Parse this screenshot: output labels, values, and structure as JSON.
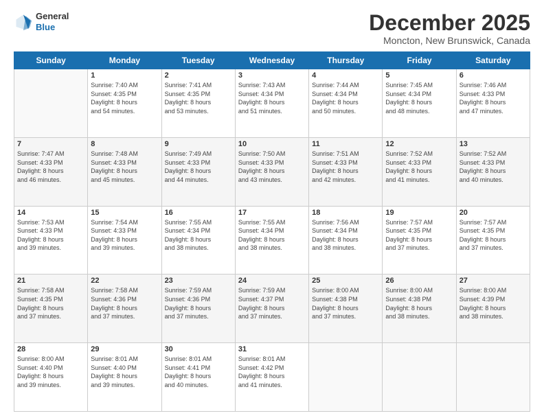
{
  "header": {
    "logo_line1": "General",
    "logo_line2": "Blue",
    "month_title": "December 2025",
    "location": "Moncton, New Brunswick, Canada"
  },
  "days_of_week": [
    "Sunday",
    "Monday",
    "Tuesday",
    "Wednesday",
    "Thursday",
    "Friday",
    "Saturday"
  ],
  "weeks": [
    [
      {
        "day": "",
        "info": ""
      },
      {
        "day": "1",
        "info": "Sunrise: 7:40 AM\nSunset: 4:35 PM\nDaylight: 8 hours\nand 54 minutes."
      },
      {
        "day": "2",
        "info": "Sunrise: 7:41 AM\nSunset: 4:35 PM\nDaylight: 8 hours\nand 53 minutes."
      },
      {
        "day": "3",
        "info": "Sunrise: 7:43 AM\nSunset: 4:34 PM\nDaylight: 8 hours\nand 51 minutes."
      },
      {
        "day": "4",
        "info": "Sunrise: 7:44 AM\nSunset: 4:34 PM\nDaylight: 8 hours\nand 50 minutes."
      },
      {
        "day": "5",
        "info": "Sunrise: 7:45 AM\nSunset: 4:34 PM\nDaylight: 8 hours\nand 48 minutes."
      },
      {
        "day": "6",
        "info": "Sunrise: 7:46 AM\nSunset: 4:33 PM\nDaylight: 8 hours\nand 47 minutes."
      }
    ],
    [
      {
        "day": "7",
        "info": "Sunrise: 7:47 AM\nSunset: 4:33 PM\nDaylight: 8 hours\nand 46 minutes."
      },
      {
        "day": "8",
        "info": "Sunrise: 7:48 AM\nSunset: 4:33 PM\nDaylight: 8 hours\nand 45 minutes."
      },
      {
        "day": "9",
        "info": "Sunrise: 7:49 AM\nSunset: 4:33 PM\nDaylight: 8 hours\nand 44 minutes."
      },
      {
        "day": "10",
        "info": "Sunrise: 7:50 AM\nSunset: 4:33 PM\nDaylight: 8 hours\nand 43 minutes."
      },
      {
        "day": "11",
        "info": "Sunrise: 7:51 AM\nSunset: 4:33 PM\nDaylight: 8 hours\nand 42 minutes."
      },
      {
        "day": "12",
        "info": "Sunrise: 7:52 AM\nSunset: 4:33 PM\nDaylight: 8 hours\nand 41 minutes."
      },
      {
        "day": "13",
        "info": "Sunrise: 7:52 AM\nSunset: 4:33 PM\nDaylight: 8 hours\nand 40 minutes."
      }
    ],
    [
      {
        "day": "14",
        "info": "Sunrise: 7:53 AM\nSunset: 4:33 PM\nDaylight: 8 hours\nand 39 minutes."
      },
      {
        "day": "15",
        "info": "Sunrise: 7:54 AM\nSunset: 4:33 PM\nDaylight: 8 hours\nand 39 minutes."
      },
      {
        "day": "16",
        "info": "Sunrise: 7:55 AM\nSunset: 4:34 PM\nDaylight: 8 hours\nand 38 minutes."
      },
      {
        "day": "17",
        "info": "Sunrise: 7:55 AM\nSunset: 4:34 PM\nDaylight: 8 hours\nand 38 minutes."
      },
      {
        "day": "18",
        "info": "Sunrise: 7:56 AM\nSunset: 4:34 PM\nDaylight: 8 hours\nand 38 minutes."
      },
      {
        "day": "19",
        "info": "Sunrise: 7:57 AM\nSunset: 4:35 PM\nDaylight: 8 hours\nand 37 minutes."
      },
      {
        "day": "20",
        "info": "Sunrise: 7:57 AM\nSunset: 4:35 PM\nDaylight: 8 hours\nand 37 minutes."
      }
    ],
    [
      {
        "day": "21",
        "info": "Sunrise: 7:58 AM\nSunset: 4:35 PM\nDaylight: 8 hours\nand 37 minutes."
      },
      {
        "day": "22",
        "info": "Sunrise: 7:58 AM\nSunset: 4:36 PM\nDaylight: 8 hours\nand 37 minutes."
      },
      {
        "day": "23",
        "info": "Sunrise: 7:59 AM\nSunset: 4:36 PM\nDaylight: 8 hours\nand 37 minutes."
      },
      {
        "day": "24",
        "info": "Sunrise: 7:59 AM\nSunset: 4:37 PM\nDaylight: 8 hours\nand 37 minutes."
      },
      {
        "day": "25",
        "info": "Sunrise: 8:00 AM\nSunset: 4:38 PM\nDaylight: 8 hours\nand 37 minutes."
      },
      {
        "day": "26",
        "info": "Sunrise: 8:00 AM\nSunset: 4:38 PM\nDaylight: 8 hours\nand 38 minutes."
      },
      {
        "day": "27",
        "info": "Sunrise: 8:00 AM\nSunset: 4:39 PM\nDaylight: 8 hours\nand 38 minutes."
      }
    ],
    [
      {
        "day": "28",
        "info": "Sunrise: 8:00 AM\nSunset: 4:40 PM\nDaylight: 8 hours\nand 39 minutes."
      },
      {
        "day": "29",
        "info": "Sunrise: 8:01 AM\nSunset: 4:40 PM\nDaylight: 8 hours\nand 39 minutes."
      },
      {
        "day": "30",
        "info": "Sunrise: 8:01 AM\nSunset: 4:41 PM\nDaylight: 8 hours\nand 40 minutes."
      },
      {
        "day": "31",
        "info": "Sunrise: 8:01 AM\nSunset: 4:42 PM\nDaylight: 8 hours\nand 41 minutes."
      },
      {
        "day": "",
        "info": ""
      },
      {
        "day": "",
        "info": ""
      },
      {
        "day": "",
        "info": ""
      }
    ]
  ]
}
